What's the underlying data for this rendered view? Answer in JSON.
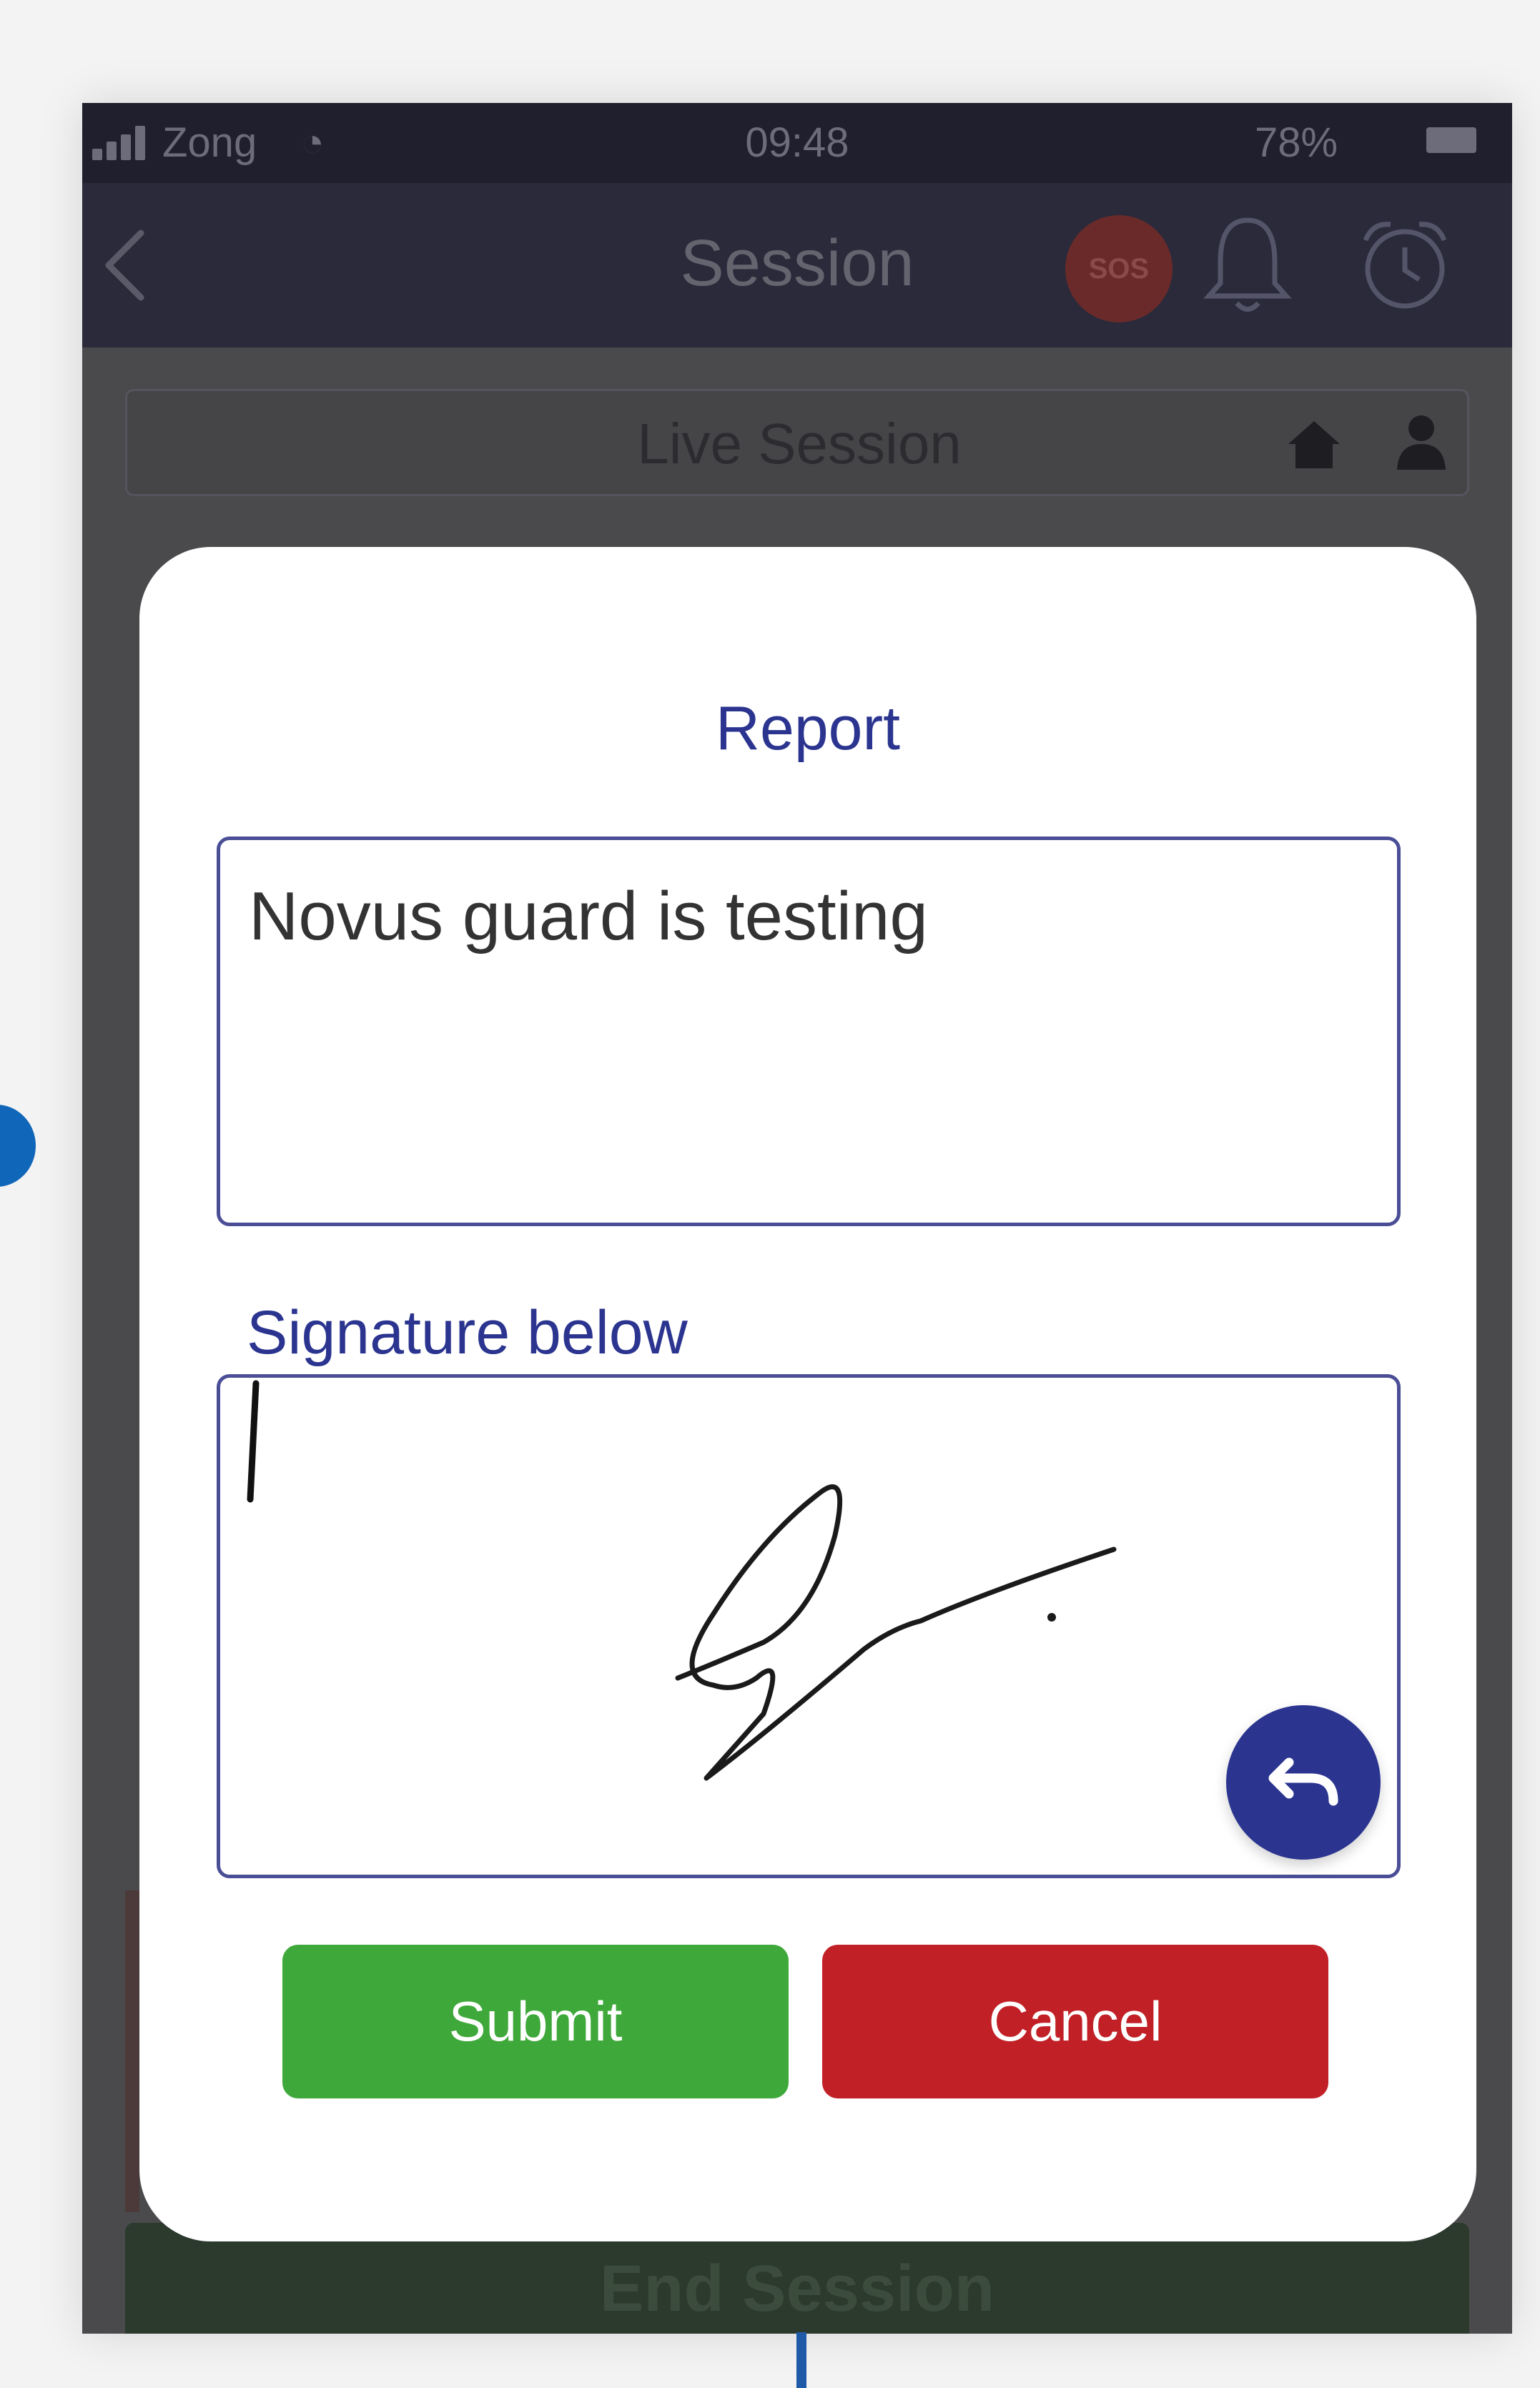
{
  "status_bar": {
    "carrier": "Zong",
    "time": "09:48",
    "battery": "78%"
  },
  "nav": {
    "title": "Session",
    "sos": "SOS"
  },
  "live_session": {
    "title": "Live Session"
  },
  "dialog": {
    "title": "Report",
    "report_text": "Novus guard is testing",
    "signature_label": "Signature below",
    "submit_label": "Submit",
    "cancel_label": "Cancel"
  },
  "footer": {
    "end_session_label": "End Session"
  },
  "colors": {
    "accent": "#2b3590",
    "submit": "#3fa83a",
    "cancel": "#c12026"
  },
  "icons": [
    "back-icon",
    "bell-icon",
    "alarm-icon",
    "home-icon",
    "user-icon",
    "undo-icon",
    "wifi-icon",
    "signal-icon",
    "battery-icon"
  ]
}
